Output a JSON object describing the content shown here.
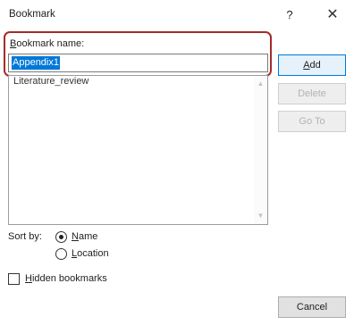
{
  "dialog": {
    "title": "Bookmark",
    "help_glyph": "?",
    "close_glyph": "✕"
  },
  "name_field": {
    "label_mnemonic": "B",
    "label_rest": "ookmark name:",
    "value": "Appendix1"
  },
  "bookmarks": {
    "items": [
      "Literature_review"
    ],
    "scroll_up_glyph": "▲",
    "scroll_down_glyph": "▼"
  },
  "buttons": {
    "add_mnemonic": "A",
    "add_rest": "dd",
    "delete": "Delete",
    "goto": "Go To",
    "cancel": "Cancel"
  },
  "sort": {
    "label": "Sort by:",
    "options": [
      {
        "mnemonic": "N",
        "rest": "ame",
        "selected": true
      },
      {
        "mnemonic": "L",
        "rest": "ocation",
        "selected": false
      }
    ]
  },
  "hidden": {
    "mnemonic": "H",
    "rest": "idden bookmarks",
    "checked": false
  },
  "colors": {
    "highlight_border": "#a52a2a",
    "selection": "#0078d7"
  }
}
